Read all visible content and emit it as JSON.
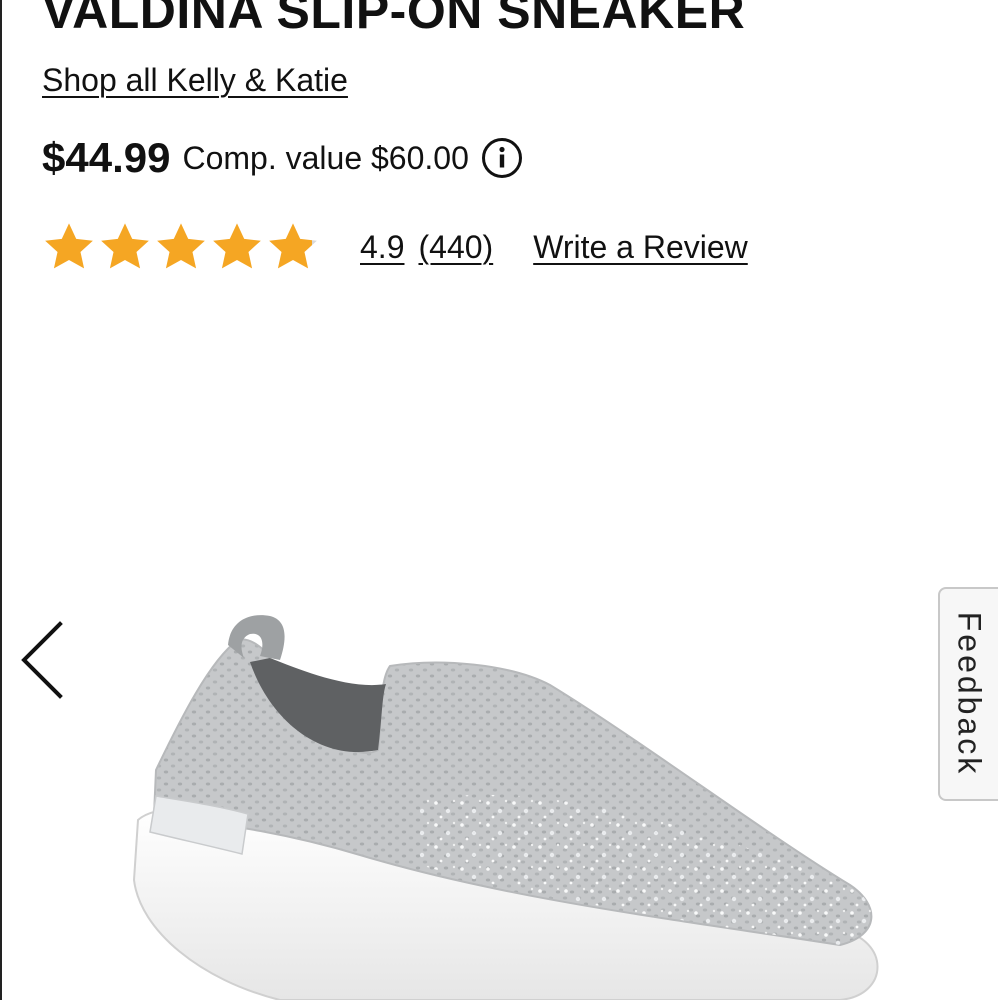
{
  "product": {
    "title": "VALDINA SLIP-ON SNEAKER",
    "brand_link": "Shop all Kelly & Katie",
    "price": "$44.99",
    "comp_value": "Comp. value $60.00"
  },
  "rating": {
    "stars": 4.9,
    "value": "4.9",
    "count": "(440)",
    "write_review": "Write a Review"
  },
  "feedback": {
    "label": "Feedback"
  },
  "icons": {
    "info": "info-icon",
    "prev": "chevron-left-icon",
    "star": "star-icon"
  },
  "colors": {
    "star": "#F5A623",
    "text": "#111111"
  }
}
